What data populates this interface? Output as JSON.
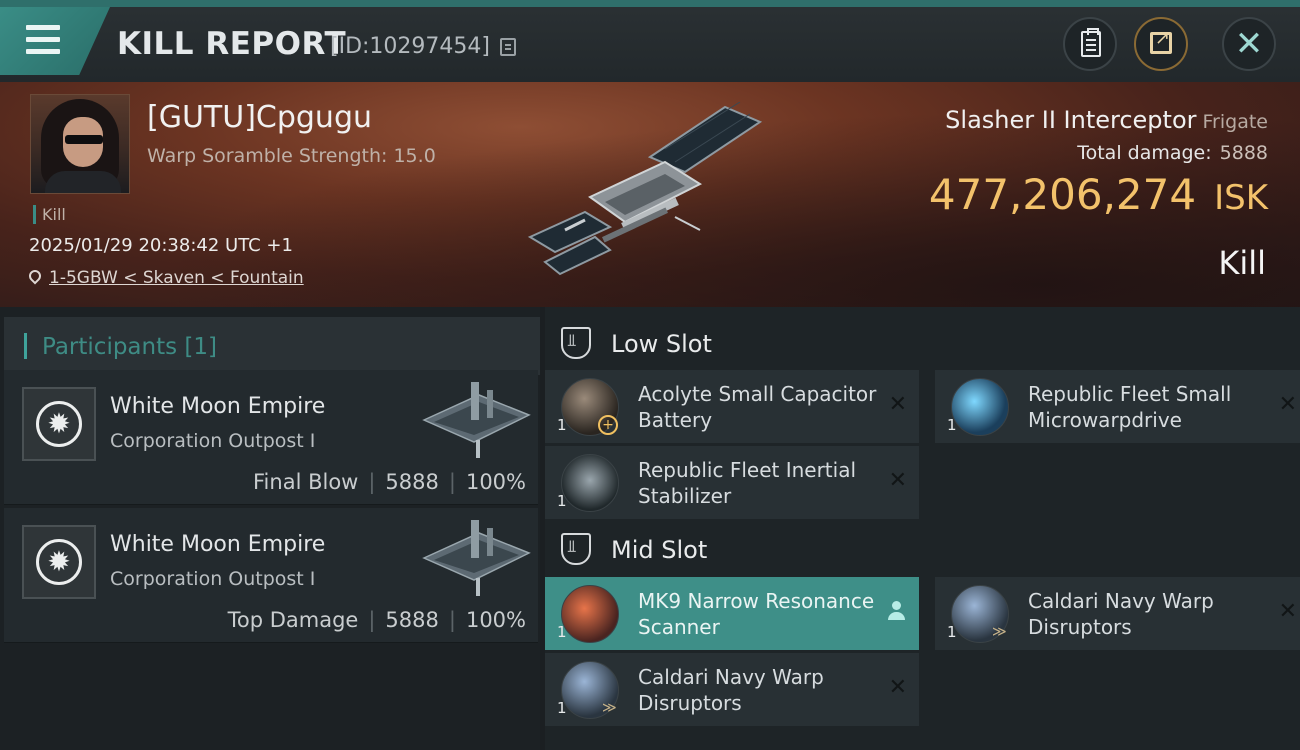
{
  "header": {
    "title": "KILL REPORT",
    "report_id": "[ID:10297454]"
  },
  "victim": {
    "name": "[GUTU]Cpgugu",
    "scramble": "Warp Soramble Strength: 15.0",
    "kill_tag": "Kill",
    "datetime": "2025/01/29 20:38:42 UTC +1",
    "location": "1-5GBW < Skaven < Fountain"
  },
  "ship": {
    "name": "Slasher II Interceptor",
    "class": "Frigate",
    "total_damage_label": "Total damage:",
    "total_damage": "5888",
    "isk_value": "477,206,274",
    "isk_unit": "ISK",
    "result": "Kill"
  },
  "participants": {
    "title": "Participants [1]",
    "rows": [
      {
        "name": "White Moon Empire",
        "type": "Corporation Outpost I",
        "role": "Final Blow",
        "damage": "5888",
        "percent": "100%"
      },
      {
        "name": "White Moon Empire",
        "type": "Corporation Outpost I",
        "role": "Top Damage",
        "damage": "5888",
        "percent": "100%"
      }
    ]
  },
  "slots": {
    "low": {
      "title": "Low Slot",
      "modules": [
        {
          "name": "Acolyte Small Capacitor Battery",
          "qty": "1",
          "icon": "capacitor-battery-icon"
        },
        {
          "name": "Republic Fleet Small Microwarpdrive",
          "qty": "1",
          "icon": "microwarpdrive-icon"
        },
        {
          "name": "Republic Fleet Inertial Stabilizer",
          "qty": "1",
          "icon": "inertial-stabilizer-icon"
        }
      ]
    },
    "mid": {
      "title": "Mid Slot",
      "modules": [
        {
          "name": "MK9 Narrow Resonance Scanner",
          "qty": "1",
          "icon": "resonance-scanner-icon"
        },
        {
          "name": "Caldari Navy Warp Disruptors",
          "qty": "1",
          "icon": "warp-disruptor-icon"
        },
        {
          "name": "Caldari Navy Warp Disruptors",
          "qty": "1",
          "icon": "warp-disruptor-icon"
        }
      ]
    }
  },
  "colors": {
    "accent": "#3e8f88",
    "isk": "#f3c26b",
    "panel": "#1e2427"
  }
}
